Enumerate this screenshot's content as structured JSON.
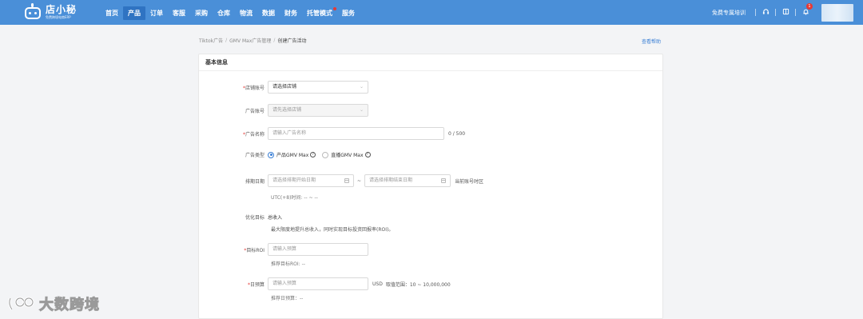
{
  "app": {
    "logo_name": "店小秘",
    "logo_slogan": "免费跨境电商ERP"
  },
  "nav": {
    "items": [
      {
        "label": "首页"
      },
      {
        "label": "产品"
      },
      {
        "label": "订单"
      },
      {
        "label": "客服"
      },
      {
        "label": "采购"
      },
      {
        "label": "仓库"
      },
      {
        "label": "物流"
      },
      {
        "label": "数据"
      },
      {
        "label": "财务"
      },
      {
        "label": "托管模式"
      },
      {
        "label": "服务"
      }
    ],
    "active_item": "产品",
    "training_link": "免费专属培训",
    "notification_count": "1"
  },
  "breadcrumb": {
    "items": [
      "Tiktok广告",
      "GMV Max广告管理",
      "创建广告活动"
    ],
    "separator": "/",
    "help_link": "查看帮助"
  },
  "form": {
    "section_title": "基本信息",
    "shop_account": {
      "label": "店铺账号",
      "required": "*",
      "placeholder": "请选择店铺"
    },
    "ad_account": {
      "label": "广告账号",
      "placeholder": "请先选择店铺"
    },
    "ad_name": {
      "label": "广告名称",
      "required": "*",
      "placeholder": "请输入广告名称",
      "counter": "0 / 500"
    },
    "ad_type": {
      "label": "广告类型",
      "options": [
        "产品GMV Max",
        "直播GMV Max"
      ],
      "selected": "产品GMV Max"
    },
    "schedule": {
      "label": "排期日期",
      "start_placeholder": "请选择排期开始日期",
      "range_separator": "~",
      "end_placeholder": "请选择排期结束日期",
      "timezone_note": "当前账号时区",
      "utc_note": "UTC(+8)时间:  --  ~  --"
    },
    "optimization": {
      "label": "优化目标",
      "value": "总收入",
      "description": "最大限度地提升总收入，同时实现目标投资回报率(ROI)。"
    },
    "target_roi": {
      "label": "目标ROI",
      "required": "*",
      "placeholder": "请输入预算",
      "suggestion": "推荐目标ROI: --"
    },
    "daily_budget": {
      "label": "日预算",
      "required": "*",
      "placeholder": "请输入预算",
      "currency": "USD",
      "range_note": "取值范围：10 ~ 10,000,000",
      "suggestion": "推荐日预算：--"
    }
  },
  "watermark": {
    "text": "大数跨境"
  },
  "colors": {
    "primary": "#4a8fd8",
    "nav_active": "#2f73c2",
    "link": "#3a7fd5",
    "required": "#e53935"
  }
}
